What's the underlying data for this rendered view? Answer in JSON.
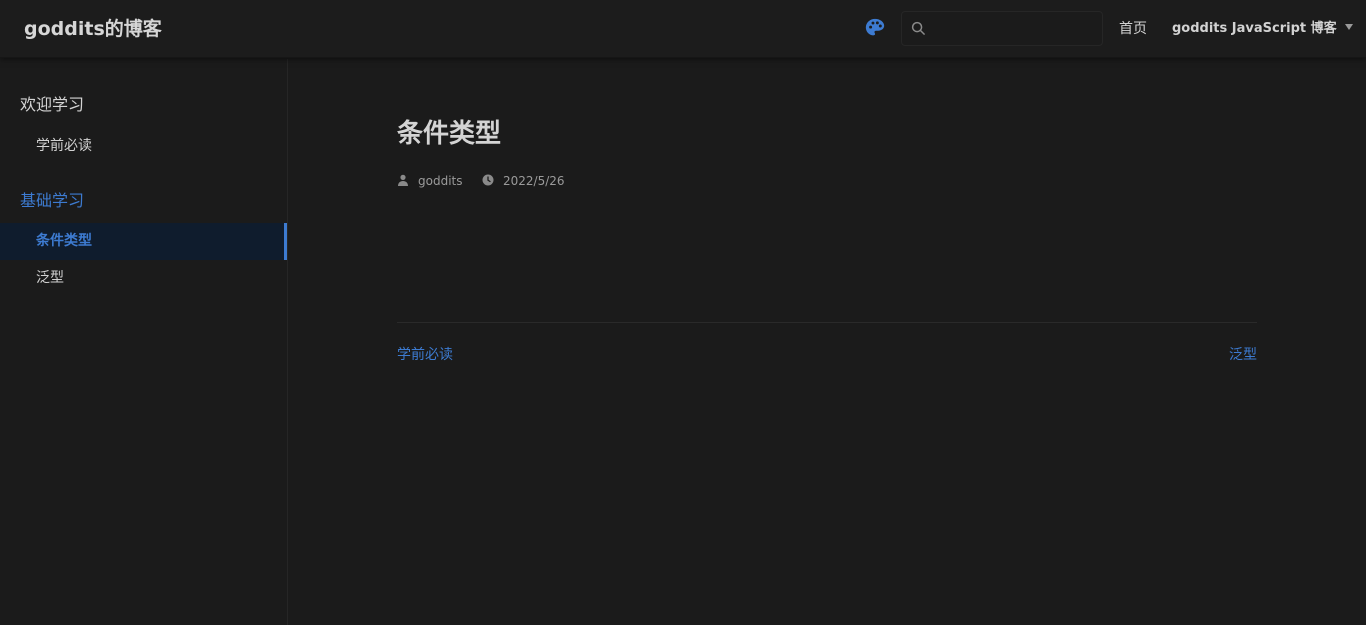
{
  "navbar": {
    "site_name": "goddits的博客",
    "search": {
      "value": "",
      "placeholder": ""
    },
    "links": {
      "home": "首页",
      "blog": "goddits JavaScript 博客"
    },
    "palette_icon": "palette-icon",
    "accent_color": "#3d7bd1"
  },
  "sidebar": {
    "groups": [
      {
        "title": "欢迎学习",
        "items": [
          {
            "label": "学前必读"
          }
        ]
      },
      {
        "title": "基础学习",
        "items": [
          {
            "label": "条件类型",
            "active": true
          },
          {
            "label": "泛型"
          }
        ]
      }
    ]
  },
  "page": {
    "title": "条件类型",
    "author": "goddits",
    "date": "2022/5/26",
    "prev": "学前必读",
    "next": "泛型"
  }
}
